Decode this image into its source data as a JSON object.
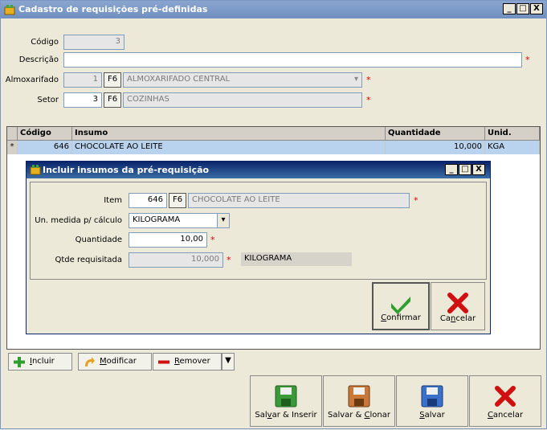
{
  "window": {
    "title": "Cadastro de requisições pré-definidas",
    "controls": {
      "minimize": "_",
      "maximize": "□",
      "close": "X"
    }
  },
  "form": {
    "codigo_label": "Código",
    "codigo_value": "3",
    "descricao_label": "Descrição",
    "descricao_value": "",
    "almox_label": "Almoxarifado",
    "almox_code": "1",
    "almox_f6": "F6",
    "almox_name": "ALMOXARIFADO CENTRAL",
    "setor_label": "Setor",
    "setor_code": "3",
    "setor_f6": "F6",
    "setor_name": "COZINHAS",
    "required_mark": "*"
  },
  "grid": {
    "headers": [
      "Código",
      "Insumo",
      "Quantidade",
      "Unid."
    ],
    "rows": [
      {
        "indicator": "*",
        "codigo": "646",
        "insumo": "CHOCOLATE AO LEITE",
        "quantidade": "10,000",
        "unid": "KGA"
      }
    ]
  },
  "dialog": {
    "title": "Incluir insumos da pré-requisição",
    "item_label": "Item",
    "item_code": "646",
    "item_f6": "F6",
    "item_name": "CHOCOLATE AO LEITE",
    "unmed_label": "Un. medida p/ cálculo",
    "unmed_value": "KILOGRAMA",
    "qtd_label": "Quantidade",
    "qtd_value": "10,00",
    "qtde_req_label": "Qtde requisitada",
    "qtde_req_value": "10,000",
    "qtde_req_unit": "KILOGRAMA",
    "confirm_pre": "",
    "confirm_u": "C",
    "confirm_post": "onfirmar",
    "cancel_pre": "Ca",
    "cancel_u": "n",
    "cancel_post": "celar"
  },
  "toolbar": {
    "incluir_u": "I",
    "incluir_post": "ncluir",
    "modificar_u": "M",
    "modificar_post": "odificar",
    "remover_u": "R",
    "remover_post": "emover"
  },
  "bottom": {
    "salvar_inserir_pre": "Sal",
    "salvar_inserir_u": "v",
    "salvar_inserir_post": "ar & Inserir",
    "salvar_clonar_pre": "Salvar & ",
    "salvar_clonar_u": "C",
    "salvar_clonar_post": "lonar",
    "salvar_u": "S",
    "salvar_post": "alvar",
    "cancelar_u": "C",
    "cancelar_post": "ancelar"
  },
  "colors": {
    "accent_green": "#2e9e2e",
    "cancel_red": "#d01010",
    "selected_row": "#b9d3ee",
    "dialog_title": "#0a246a"
  }
}
